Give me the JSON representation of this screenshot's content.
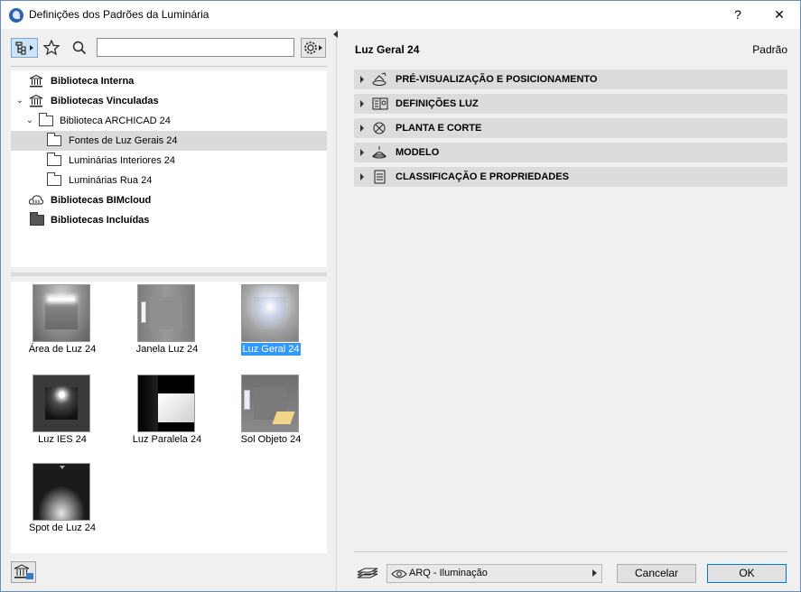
{
  "window": {
    "title": "Definições dos Padrões da Luminária",
    "help_label": "?",
    "close_label": "✕"
  },
  "search": {
    "value": "",
    "placeholder": ""
  },
  "tree": {
    "items": [
      {
        "label": "Biblioteca Interna",
        "icon": "library-icon",
        "bold": true
      },
      {
        "label": "Bibliotecas Vinculadas",
        "icon": "linked-library-icon",
        "bold": true,
        "expanded": true
      },
      {
        "label": "Biblioteca ARCHICAD 24",
        "icon": "folder-icon",
        "bold": false,
        "expanded": true
      },
      {
        "label": "Fontes de Luz Gerais 24",
        "icon": "folder-icon",
        "bold": false,
        "selected": true
      },
      {
        "label": "Luminárias Interiores 24",
        "icon": "folder-icon",
        "bold": false
      },
      {
        "label": "Luminárias Rua 24",
        "icon": "folder-icon",
        "bold": false
      },
      {
        "label": "Bibliotecas BIMcloud",
        "icon": "bimcloud-icon",
        "bold": true
      },
      {
        "label": "Bibliotecas Incluídas",
        "icon": "folder-dark-icon",
        "bold": true
      }
    ]
  },
  "objects": [
    {
      "label": "Área de Luz 24",
      "selected": false
    },
    {
      "label": "Janela Luz 24",
      "selected": false
    },
    {
      "label": "Luz Geral 24",
      "selected": true
    },
    {
      "label": "Luz IES 24",
      "selected": false
    },
    {
      "label": "Luz Paralela 24",
      "selected": false
    },
    {
      "label": "Sol Objeto 24",
      "selected": false
    },
    {
      "label": "Spot de Luz 24",
      "selected": false
    }
  ],
  "details": {
    "name": "Luz Geral 24",
    "status": "Padrão",
    "sections": [
      {
        "label": "PRÉ-VISUALIZAÇÃO E POSICIONAMENTO",
        "icon": "preview-icon"
      },
      {
        "label": "DEFINIÇÕES LUZ",
        "icon": "light-settings-icon"
      },
      {
        "label": "PLANTA E CORTE",
        "icon": "plan-section-icon"
      },
      {
        "label": "MODELO",
        "icon": "model-icon"
      },
      {
        "label": "CLASSIFICAÇÃO E PROPRIEDADES",
        "icon": "classification-icon"
      }
    ]
  },
  "footer": {
    "layer_value": "ARQ - Iluminação",
    "cancel_label": "Cancelar",
    "ok_label": "OK"
  }
}
